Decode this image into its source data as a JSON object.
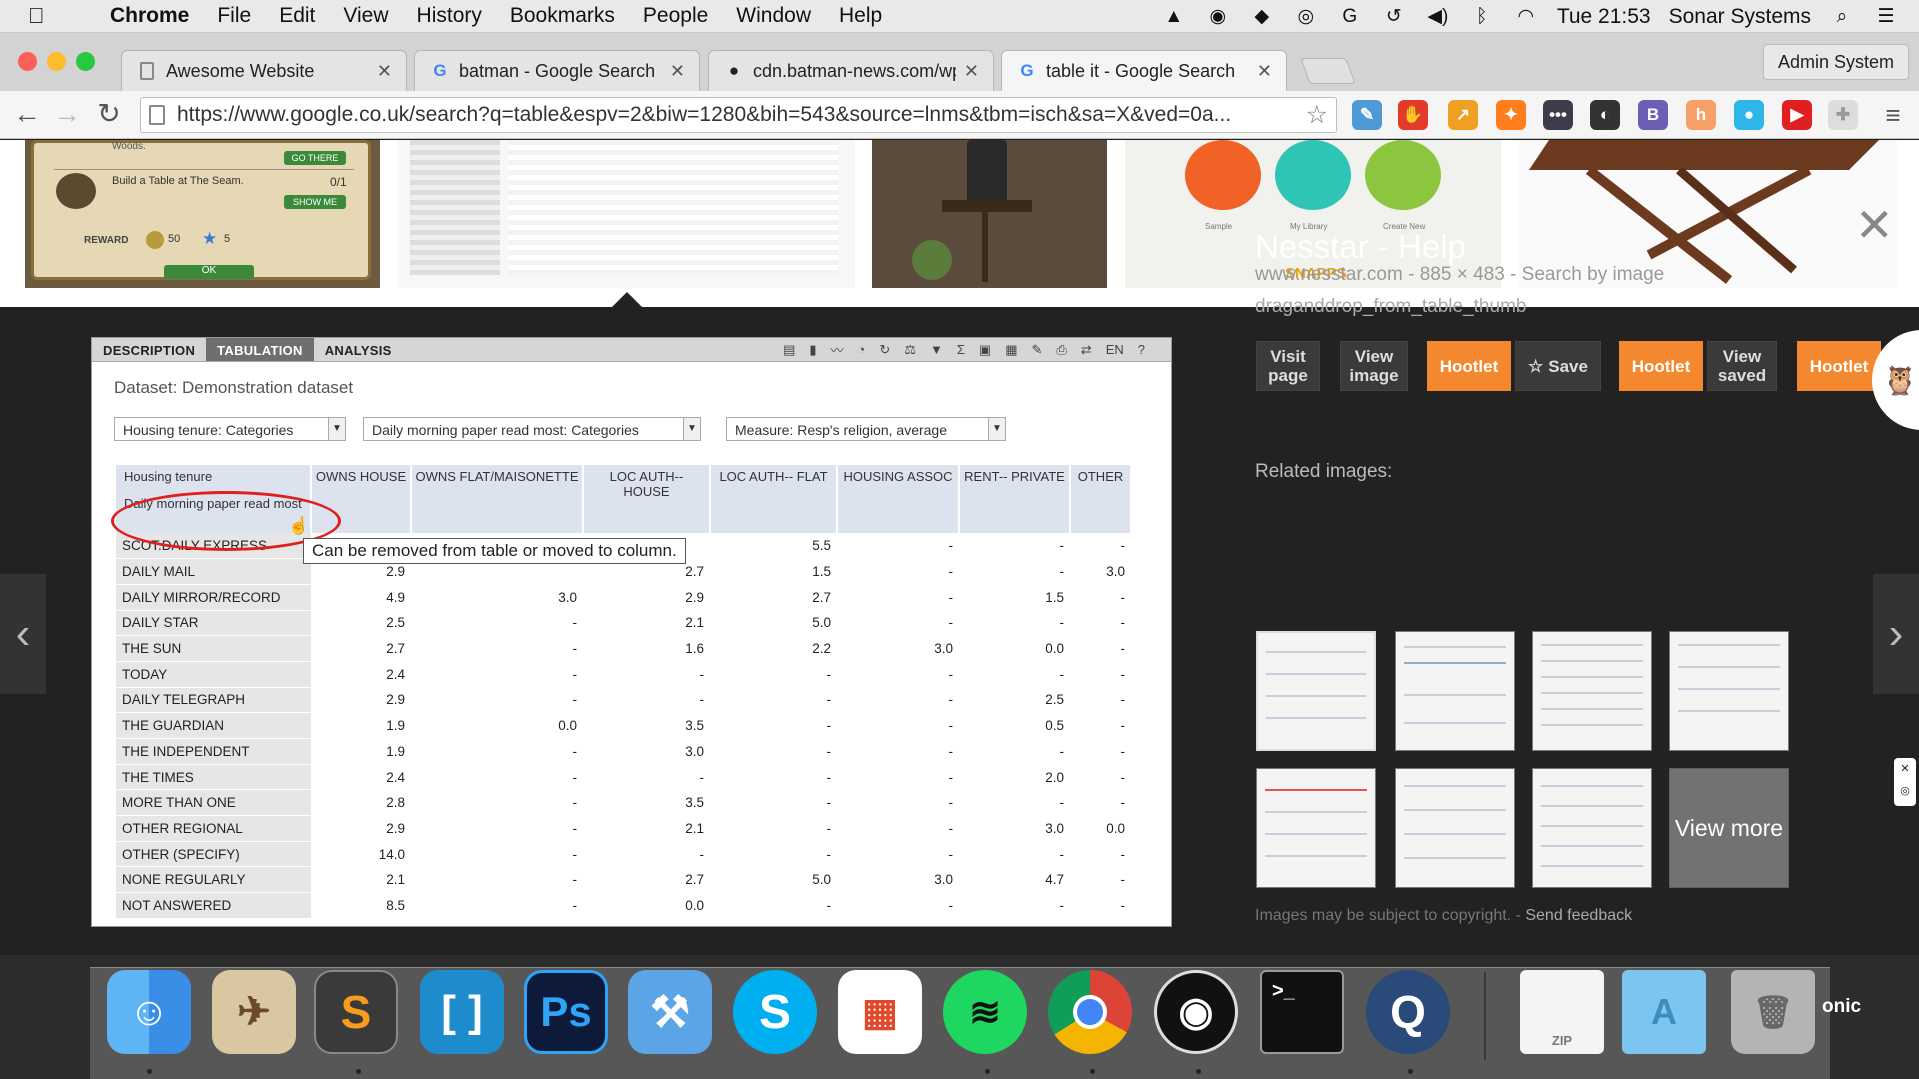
{
  "menubar": {
    "app": "Chrome",
    "menus": [
      "File",
      "Edit",
      "View",
      "History",
      "Bookmarks",
      "People",
      "Window",
      "Help"
    ],
    "clock": "Tue 21:53",
    "user": "Sonar Systems"
  },
  "tabs": [
    {
      "title": "Awesome Website",
      "favicon": "page-icon"
    },
    {
      "title": "batman - Google Search",
      "favicon": "google-icon"
    },
    {
      "title": "cdn.batman-news.com/wp",
      "favicon": "github-icon"
    },
    {
      "title": "table it - Google Search",
      "favicon": "google-icon"
    }
  ],
  "profile_button": "Admin System",
  "toolbar": {
    "url": "https://www.google.co.uk/search?q=table&espv=2&biw=1280&bih=543&source=lnms&tbm=isch&sa=X&ved=0a..."
  },
  "thumbnails": {
    "game": {
      "quest_label": "Woods.",
      "go_there": "GO THERE",
      "build_task": "Build a Table at The Seam.",
      "build_count": "0/1",
      "show_me": "SHOW ME",
      "reward_label": "REWARD",
      "coins": "50",
      "stars": "5",
      "ok": "OK"
    },
    "app": {
      "labels": [
        "Sample",
        "My Library",
        "Create New"
      ],
      "brand": "SNAPPS"
    }
  },
  "nesstar": {
    "tabs": [
      "DESCRIPTION",
      "TABULATION",
      "ANALYSIS"
    ],
    "active_tab": "TABULATION",
    "lang": "EN",
    "help": "?",
    "dataset": "Dataset: Demonstration dataset",
    "selectors": [
      "Housing tenure: Categories",
      "Daily morning paper read most: Categories",
      "Measure: Resp's religion, average"
    ],
    "row_header_top": "Housing tenure",
    "row_header_bottom": "Daily morning paper read most",
    "columns": [
      "OWNS HOUSE",
      "OWNS FLAT/MAISONETTE",
      "LOC AUTH-- HOUSE",
      "LOC AUTH-- FLAT",
      "HOUSING ASSOC",
      "RENT-- PRIVATE",
      "OTHER"
    ],
    "rows": [
      {
        "label": "SCOT.DAILY EXPRESS",
        "values": [
          "",
          "",
          "",
          "5.5",
          "-",
          "-",
          "-"
        ]
      },
      {
        "label": "DAILY MAIL",
        "values": [
          "2.9",
          "",
          "2.7",
          "1.5",
          "-",
          "-",
          "3.0"
        ]
      },
      {
        "label": "DAILY MIRROR/RECORD",
        "values": [
          "4.9",
          "3.0",
          "2.9",
          "2.7",
          "-",
          "1.5",
          "-"
        ]
      },
      {
        "label": "DAILY STAR",
        "values": [
          "2.5",
          "-",
          "2.1",
          "5.0",
          "-",
          "-",
          "-"
        ]
      },
      {
        "label": "THE SUN",
        "values": [
          "2.7",
          "-",
          "1.6",
          "2.2",
          "3.0",
          "0.0",
          "-"
        ]
      },
      {
        "label": "TODAY",
        "values": [
          "2.4",
          "-",
          "-",
          "-",
          "-",
          "-",
          "-"
        ]
      },
      {
        "label": "DAILY TELEGRAPH",
        "values": [
          "2.9",
          "-",
          "-",
          "-",
          "-",
          "2.5",
          "-"
        ]
      },
      {
        "label": "THE GUARDIAN",
        "values": [
          "1.9",
          "0.0",
          "3.5",
          "-",
          "-",
          "0.5",
          "-"
        ]
      },
      {
        "label": "THE INDEPENDENT",
        "values": [
          "1.9",
          "-",
          "3.0",
          "-",
          "-",
          "-",
          "-"
        ]
      },
      {
        "label": "THE TIMES",
        "values": [
          "2.4",
          "-",
          "-",
          "-",
          "-",
          "2.0",
          "-"
        ]
      },
      {
        "label": "MORE THAN ONE",
        "values": [
          "2.8",
          "-",
          "3.5",
          "-",
          "-",
          "-",
          "-"
        ]
      },
      {
        "label": "OTHER REGIONAL",
        "values": [
          "2.9",
          "-",
          "2.1",
          "-",
          "-",
          "3.0",
          "0.0"
        ]
      },
      {
        "label": "OTHER (SPECIFY)",
        "values": [
          "14.0",
          "-",
          "-",
          "-",
          "-",
          "-",
          "-"
        ]
      },
      {
        "label": "NONE REGULARLY",
        "values": [
          "2.1",
          "-",
          "2.7",
          "5.0",
          "3.0",
          "4.7",
          "-"
        ]
      },
      {
        "label": "NOT ANSWERED",
        "values": [
          "8.5",
          "-",
          "0.0",
          "-",
          "-",
          "-",
          "-"
        ]
      }
    ],
    "tooltip": "Can be removed from table or moved to column."
  },
  "info": {
    "title": "Nesstar - Help",
    "meta": "www.nesstar.com - 885 × 483 - Search by image",
    "filename": "draganddrop_from_table_thumb",
    "buttons": {
      "visit": "Visit page",
      "view_image": "View image",
      "hootlet1": "Hootlet",
      "save": "Save",
      "hootlet2": "Hootlet",
      "view_saved": "View saved",
      "hootlet3": "Hootlet"
    },
    "related_title": "Related images:",
    "view_more": "View more",
    "copyright": "Images may be subject to copyright.",
    "feedback": "Send feedback"
  },
  "dock": {
    "apps": [
      "Finder",
      "Preview",
      "Sublime Text",
      "Brackets",
      "Photoshop",
      "Xcode",
      "Skype",
      "Launchpad",
      "Spotify",
      "Chrome",
      "OBS",
      "Terminal",
      "QuickTime",
      "Archive Utility",
      "Applications",
      "Trash"
    ],
    "ps_label": "Ps",
    "zip_label": "ZIP",
    "edge_text": "onic"
  },
  "colors": {
    "hootlet": "#f4882f",
    "google_blue": "#4285f4",
    "circle_red": "#e0201f"
  }
}
